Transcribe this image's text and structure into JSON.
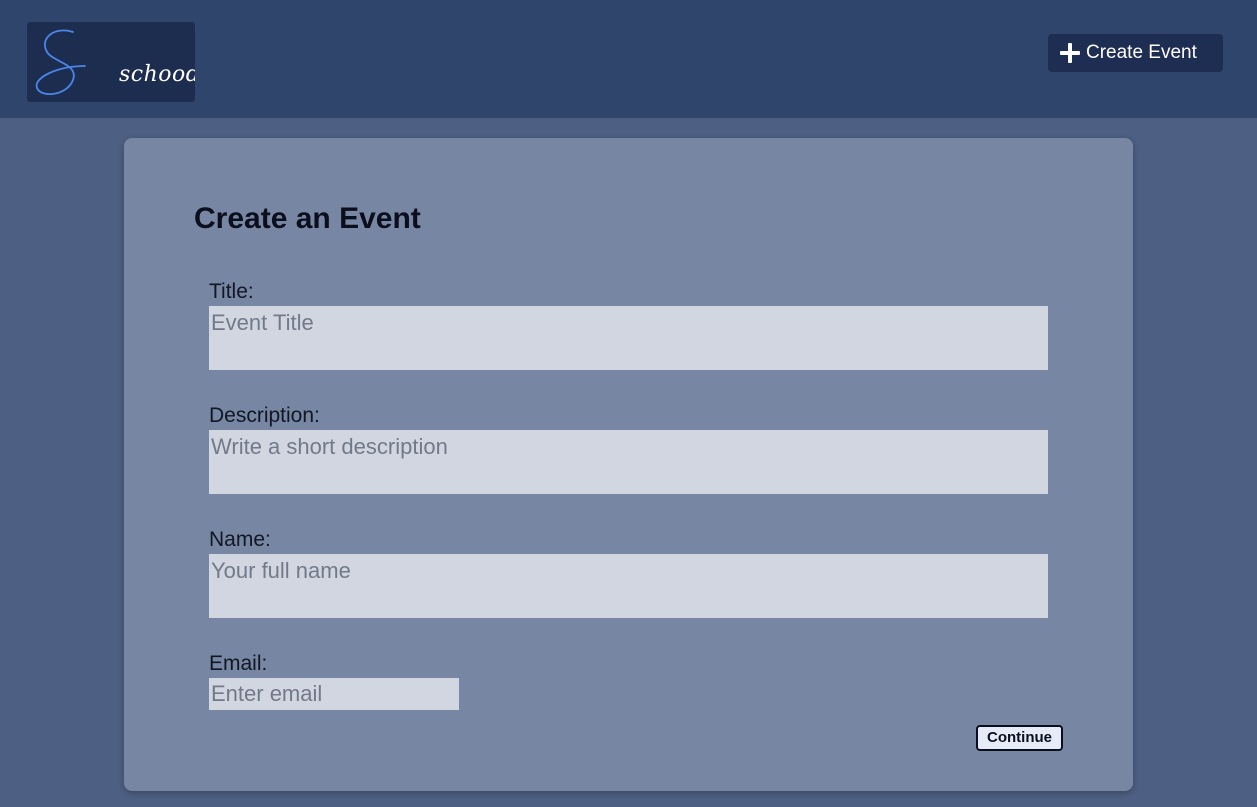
{
  "header": {
    "logo_text": "schoodle",
    "create_button_label": "Create Event",
    "icons": {
      "logo_mark": "script-s-logo",
      "create": "plus-icon"
    }
  },
  "form": {
    "title": "Create an Event",
    "fields": [
      {
        "label": "Title:",
        "placeholder": "Event Title"
      },
      {
        "label": "Description:",
        "placeholder": "Write a short description"
      },
      {
        "label": "Name:",
        "placeholder": "Your full name"
      },
      {
        "label": "Email:",
        "placeholder": "Enter email"
      }
    ],
    "continue_label": "Continue"
  },
  "colors": {
    "page_background": "#4d5f82",
    "topbar_background": "#30456c",
    "logo_background": "#1d2d50",
    "card_background": "#7786a2",
    "input_background": "#d1d6e1",
    "logo_accent": "#4a86e8"
  }
}
